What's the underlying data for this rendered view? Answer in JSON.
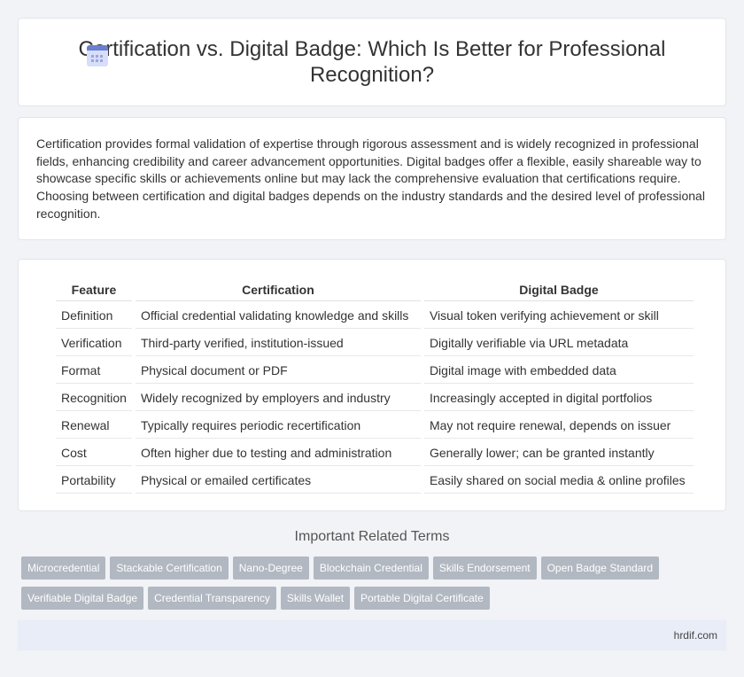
{
  "header": {
    "title": "Certification vs. Digital Badge: Which Is Better for Professional Recognition?",
    "icon": "calendar-icon"
  },
  "intro": {
    "text": "Certification provides formal validation of expertise through rigorous assessment and is widely recognized in professional fields, enhancing credibility and career advancement opportunities. Digital badges offer a flexible, easily shareable way to showcase specific skills or achievements online but may lack the comprehensive evaluation that certifications require. Choosing between certification and digital badges depends on the industry standards and the desired level of professional recognition."
  },
  "table": {
    "headers": [
      "Feature",
      "Certification",
      "Digital Badge"
    ],
    "rows": [
      [
        "Definition",
        "Official credential validating knowledge and skills",
        "Visual token verifying achievement or skill"
      ],
      [
        "Verification",
        "Third-party verified, institution-issued",
        "Digitally verifiable via URL metadata"
      ],
      [
        "Format",
        "Physical document or PDF",
        "Digital image with embedded data"
      ],
      [
        "Recognition",
        "Widely recognized by employers and industry",
        "Increasingly accepted in digital portfolios"
      ],
      [
        "Renewal",
        "Typically requires periodic recertification",
        "May not require renewal, depends on issuer"
      ],
      [
        "Cost",
        "Often higher due to testing and administration",
        "Generally lower; can be granted instantly"
      ],
      [
        "Portability",
        "Physical or emailed certificates",
        "Easily shared on social media & online profiles"
      ]
    ]
  },
  "related": {
    "title": "Important Related Terms",
    "tags": [
      "Microcredential",
      "Stackable Certification",
      "Nano-Degree",
      "Blockchain Credential",
      "Skills Endorsement",
      "Open Badge Standard",
      "Verifiable Digital Badge",
      "Credential Transparency",
      "Skills Wallet",
      "Portable Digital Certificate"
    ]
  },
  "footer": {
    "site": "hrdif.com"
  },
  "colors": {
    "tag_bg": "#b2b8c1",
    "footer_bg": "#e8edf7",
    "icon_accent": "#6a7fd1"
  }
}
